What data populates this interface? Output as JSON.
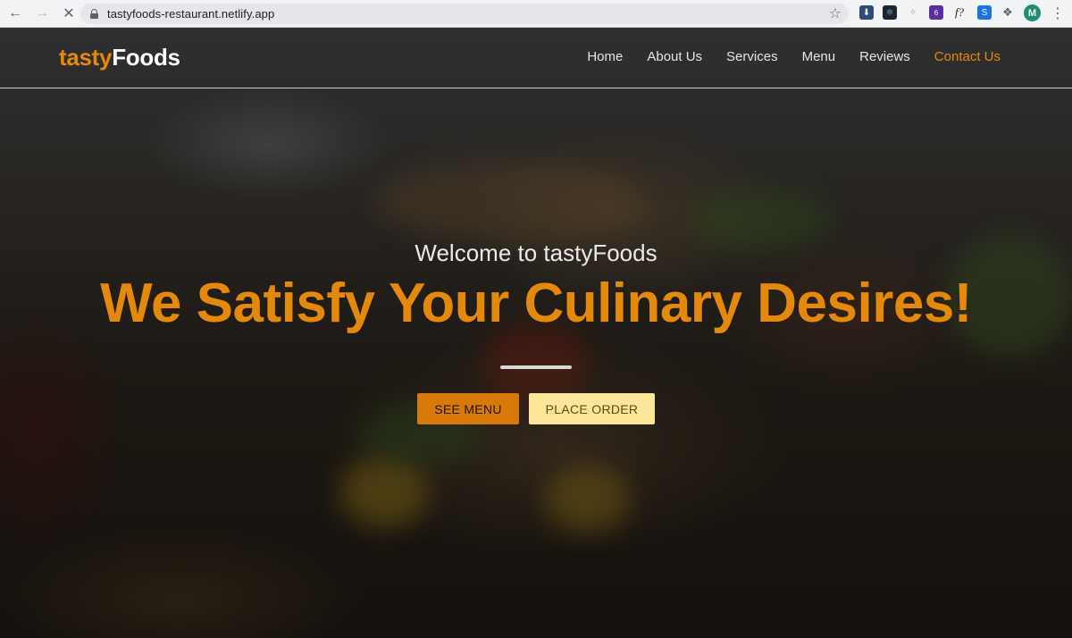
{
  "browser": {
    "url": "tastyfoods-restaurant.netlify.app",
    "extension_badge": "6",
    "profile_initial": "M",
    "extension_text": "f?"
  },
  "site": {
    "logo_part1": "tasty",
    "logo_part2": "Foods",
    "nav": [
      {
        "label": "Home"
      },
      {
        "label": "About Us"
      },
      {
        "label": "Services"
      },
      {
        "label": "Menu"
      },
      {
        "label": "Reviews"
      },
      {
        "label": "Contact Us",
        "active": true
      }
    ]
  },
  "hero": {
    "welcome": "Welcome to tastyFoods",
    "headline": "We Satisfy Your Culinary Desires!",
    "primary_button": "SEE MENU",
    "secondary_button": "PLACE ORDER"
  },
  "colors": {
    "brand_orange": "#e5890c",
    "primary_button_bg": "#d87a0a",
    "secondary_button_bg": "#fbe69a"
  }
}
